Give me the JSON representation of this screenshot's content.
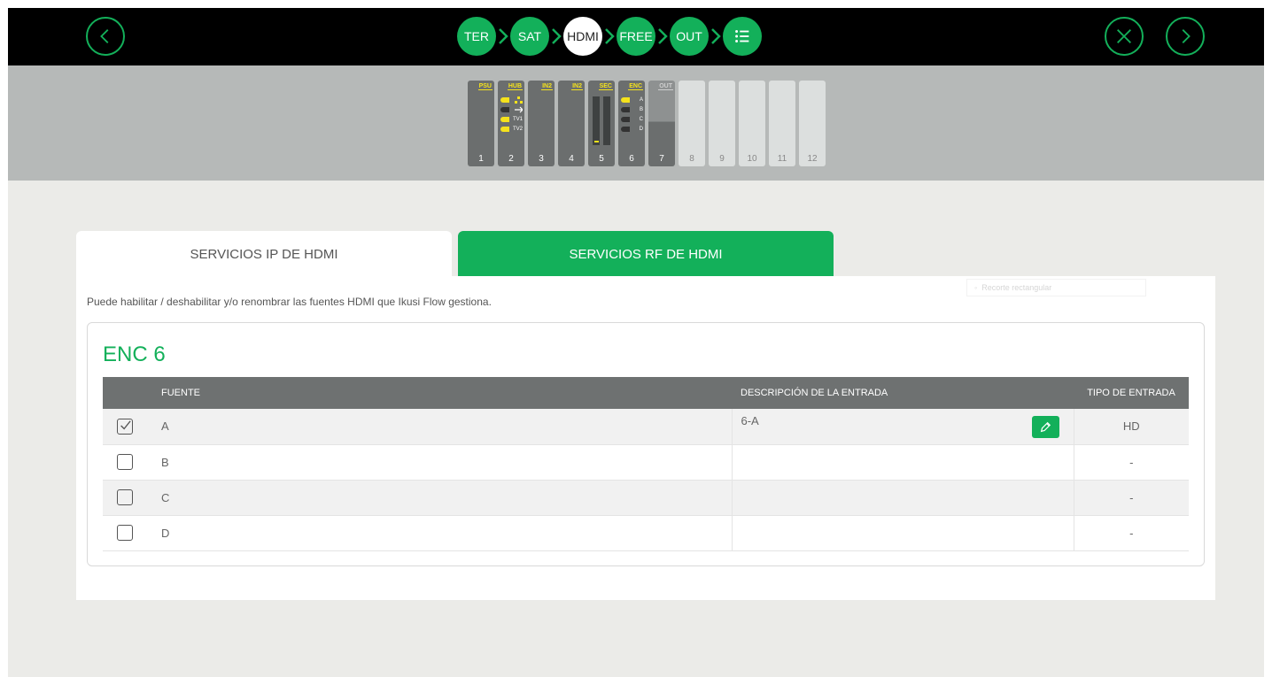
{
  "topbar": {
    "steps": [
      {
        "label": "TER",
        "active": false
      },
      {
        "label": "SAT",
        "active": false
      },
      {
        "label": "HDMI",
        "active": true
      },
      {
        "label": "FREE",
        "active": false
      },
      {
        "label": "OUT",
        "active": false
      }
    ],
    "icons": {
      "back": "chevron-left-icon",
      "close": "close-icon",
      "next": "chevron-right-icon",
      "list": "list-icon"
    },
    "accent_color": "#13b05a"
  },
  "rack": {
    "slots": [
      {
        "num": "1",
        "label": "PSU"
      },
      {
        "num": "2",
        "label": "HUB",
        "items": [
          "",
          "",
          "TV1",
          "TV2"
        ]
      },
      {
        "num": "3",
        "label": "IN2"
      },
      {
        "num": "4",
        "label": "IN2"
      },
      {
        "num": "5",
        "label": "SEC"
      },
      {
        "num": "6",
        "label": "ENC",
        "items": [
          "A",
          "B",
          "C",
          "D"
        ]
      },
      {
        "num": "7",
        "label": "OUT"
      },
      {
        "num": "8",
        "label": ""
      },
      {
        "num": "9",
        "label": ""
      },
      {
        "num": "10",
        "label": ""
      },
      {
        "num": "11",
        "label": ""
      },
      {
        "num": "12",
        "label": ""
      }
    ]
  },
  "tabs": {
    "ip": "SERVICIOS IP DE HDMI",
    "rf": "SERVICIOS RF DE HDMI"
  },
  "panel": {
    "hint": "Puede habilitar / deshabilitar y/o renombrar las fuentes HDMI que Ikusi Flow gestiona.",
    "ghost_text": "Recorte rectangular",
    "card_title": "ENC 6",
    "columns": {
      "source": "FUENTE",
      "description": "DESCRIPCIÓN DE LA ENTRADA",
      "type": "TIPO DE ENTRADA"
    },
    "rows": [
      {
        "source": "A",
        "checked": true,
        "description": "6-A",
        "type": "HD"
      },
      {
        "source": "B",
        "checked": false,
        "description": "",
        "type": "-"
      },
      {
        "source": "C",
        "checked": false,
        "description": "",
        "type": "-"
      },
      {
        "source": "D",
        "checked": false,
        "description": "",
        "type": "-"
      }
    ]
  }
}
